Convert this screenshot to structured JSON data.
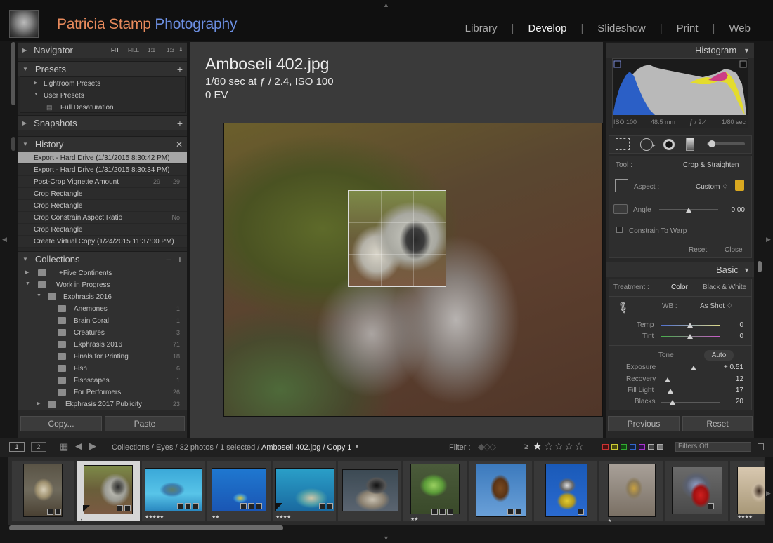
{
  "app": {
    "brand_name": "Patricia Stamp",
    "brand_suffix": "Photography",
    "modules": [
      "Library",
      "Develop",
      "Slideshow",
      "Print",
      "Web"
    ],
    "active_module": "Develop"
  },
  "left": {
    "navigator": {
      "title": "Navigator",
      "zoom": [
        "FIT",
        "FILL",
        "1:1",
        "1:3"
      ]
    },
    "presets": {
      "title": "Presets",
      "items": [
        "Lightroom Presets",
        "User Presets",
        "Full Desaturation"
      ]
    },
    "snapshots": {
      "title": "Snapshots"
    },
    "history": {
      "title": "History",
      "items": [
        {
          "label": "Export - Hard Drive (1/31/2015 8:30:42 PM)",
          "a": "",
          "b": ""
        },
        {
          "label": "Export - Hard Drive (1/31/2015 8:30:34 PM)",
          "a": "",
          "b": ""
        },
        {
          "label": "Post-Crop Vignette Amount",
          "a": "-29",
          "b": "-29"
        },
        {
          "label": "Crop Rectangle",
          "a": "",
          "b": ""
        },
        {
          "label": "Crop Rectangle",
          "a": "",
          "b": ""
        },
        {
          "label": "Crop Constrain Aspect Ratio",
          "a": "",
          "b": "No"
        },
        {
          "label": "Crop Rectangle",
          "a": "",
          "b": ""
        },
        {
          "label": "Create Virtual Copy (1/24/2015 11:37:00 PM)",
          "a": "",
          "b": ""
        }
      ]
    },
    "collections": {
      "title": "Collections",
      "items": [
        {
          "label": "+Five Continents",
          "count": ""
        },
        {
          "label": "Work in Progress",
          "count": ""
        },
        {
          "label": "Exphrasis 2016",
          "count": ""
        },
        {
          "label": "Anemones",
          "count": "1"
        },
        {
          "label": "Brain Coral",
          "count": "1"
        },
        {
          "label": "Creatures",
          "count": "3"
        },
        {
          "label": "Ekphrasis 2016",
          "count": "71"
        },
        {
          "label": "Finals for Printing",
          "count": "18"
        },
        {
          "label": "Fish",
          "count": "6"
        },
        {
          "label": "Fishscapes",
          "count": "1"
        },
        {
          "label": "For Performers",
          "count": "26"
        },
        {
          "label": "Ekphrasis 2017 Publicity",
          "count": "23"
        }
      ]
    },
    "copy_label": "Copy...",
    "paste_label": "Paste"
  },
  "photo": {
    "filename": "Amboseli 402.jpg",
    "exposure": "1/80 sec at ƒ / 2.4, ISO 100",
    "ev": "0 EV"
  },
  "right": {
    "histogram": {
      "title": "Histogram",
      "iso": "ISO 100",
      "focal": "48.5 mm",
      "aperture": "ƒ / 2.4",
      "shutter": "1/80 sec"
    },
    "crop": {
      "tool_label": "Tool :",
      "tool_value": "Crop & Straighten",
      "aspect_label": "Aspect :",
      "aspect_value": "Custom ♢",
      "angle_label": "Angle",
      "angle_value": "0.00",
      "angle_pos": 0.5,
      "constrain_label": "Constrain To Warp",
      "reset_label": "Reset",
      "close_label": "Close"
    },
    "basic": {
      "title": "Basic",
      "treatment_label": "Treatment :",
      "color_label": "Color",
      "bw_label": "Black & White",
      "wb_label": "WB :",
      "wb_value": "As Shot ♢",
      "temp_label": "Temp",
      "temp_value": "0",
      "temp_pos": 0.5,
      "tint_label": "Tint",
      "tint_value": "0",
      "tint_pos": 0.5,
      "tone_label": "Tone",
      "auto_label": "Auto",
      "exposure_label": "Exposure",
      "exposure_value": "+ 0.51",
      "exposure_pos": 0.56,
      "recovery_label": "Recovery",
      "recovery_value": "12",
      "recovery_pos": 0.12,
      "filllight_label": "Fill Light",
      "filllight_value": "17",
      "filllight_pos": 0.17,
      "blacks_label": "Blacks",
      "blacks_value": "20",
      "blacks_pos": 0.2
    },
    "previous_label": "Previous",
    "reset_label": "Reset"
  },
  "toolbar": {
    "view1": "1",
    "view2": "2",
    "path": "Collections / Eyes / 32 photos / 1 selected /",
    "current": "Amboseli 402.jpg / Copy 1",
    "filter_label": "Filter :",
    "ge": "≥",
    "filters_off": "Filters Off"
  },
  "colors": {
    "brand_name": "#e88a5c",
    "brand_suffix": "#6c8fe2",
    "history_selected": "#a6a6a6",
    "filmstrip_selected": "#d6d6d6"
  }
}
